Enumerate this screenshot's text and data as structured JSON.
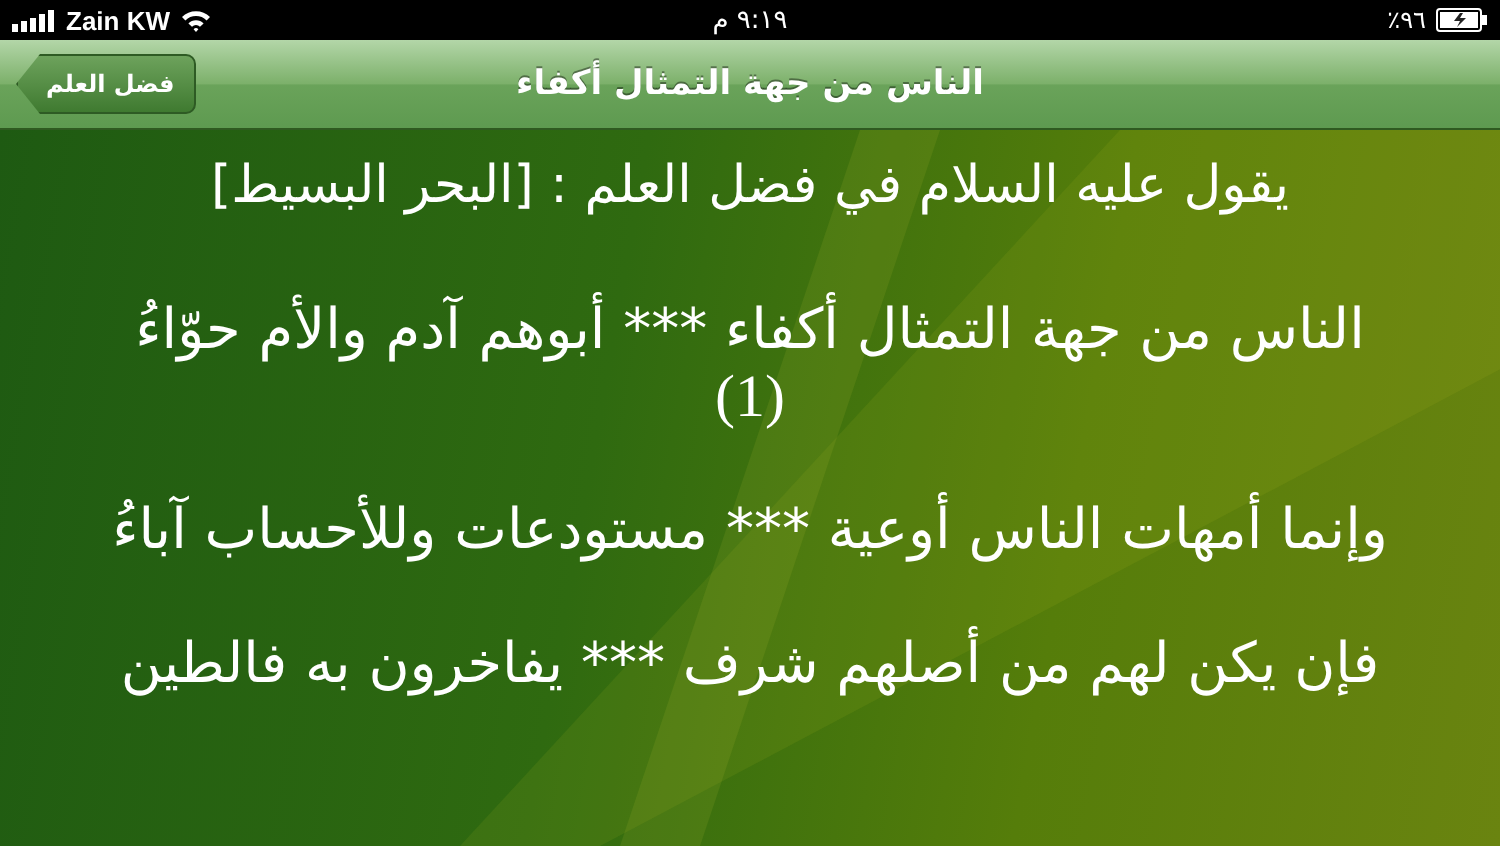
{
  "status_bar": {
    "carrier": "Zain KW",
    "time": "٩:١٩ م",
    "battery": "٪٩٦"
  },
  "nav_bar": {
    "back_button": "فضل العلم",
    "title": "الناس من جهة التمثال أكفاء"
  },
  "content": {
    "heading": "يقول عليه السلام في فضل العلم : [البحر البسيط]",
    "verses": [
      {
        "text": "الناس من جهة التمثال أكفاء *** أبوهم آدم والأم حوّاءُ",
        "note": "(1)"
      },
      {
        "text": "وإنما أمهات الناس أوعية *** مستودعات وللأحساب آباءُ"
      },
      {
        "text": "فإن يكن لهم من أصلهم شرف *** يفاخرون به فالطين"
      }
    ]
  }
}
